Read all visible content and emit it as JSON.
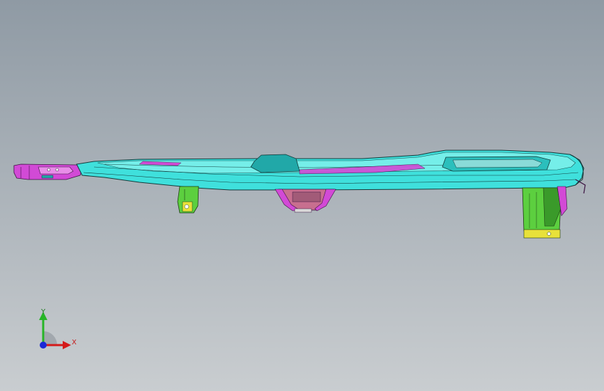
{
  "viewport": {
    "background_top": "#8f9aa4",
    "background_bottom": "#c9cdd0"
  },
  "model": {
    "colors": {
      "cyan": "#3fe0dc",
      "cyan_dark": "#21a8a8",
      "cyan_light": "#7ff1ec",
      "magenta": "#d24ad6",
      "magenta_light": "#e88ee8",
      "green": "#5ccf3f",
      "green_dark": "#3a9a2a",
      "yellow": "#e8e13a",
      "pink": "#d07a9a",
      "edge": "#123a3a"
    }
  },
  "triad": {
    "x_label": "X",
    "y_label": "Y",
    "colors": {
      "x": "#d41a1a",
      "y": "#27b527",
      "z": "#1b28d6"
    }
  }
}
